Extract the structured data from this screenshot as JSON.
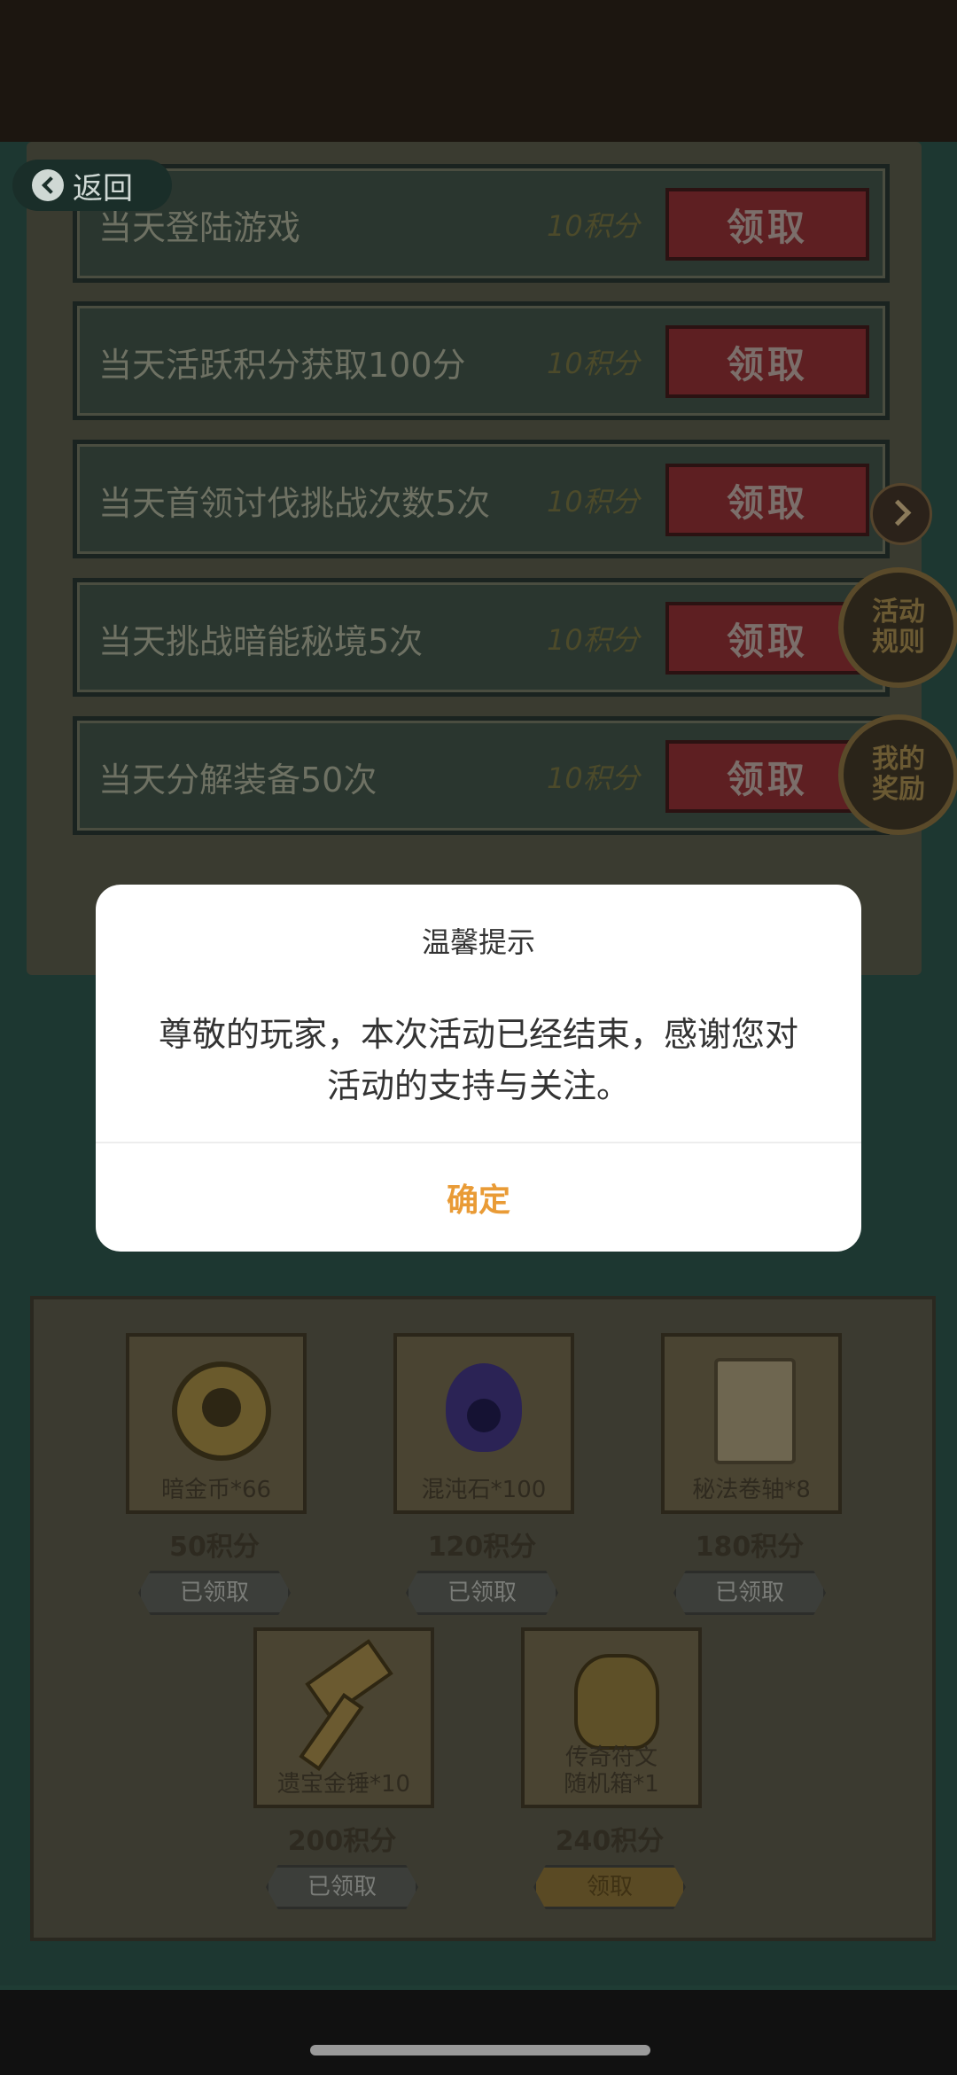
{
  "header": {
    "back_label": "返回"
  },
  "tasks": [
    {
      "name": "当天登陆游戏",
      "points": "10积分",
      "button": "领取"
    },
    {
      "name": "当天活跃积分获取100分",
      "points": "10积分",
      "button": "领取"
    },
    {
      "name": "当天首领讨伐挑战次数5次",
      "points": "10积分",
      "button": "领取"
    },
    {
      "name": "当天挑战暗能秘境5次",
      "points": "10积分",
      "button": "领取"
    },
    {
      "name": "当天分解装备50次",
      "points": "10积分",
      "button": "领取"
    }
  ],
  "side": {
    "rules_line1": "活动",
    "rules_line2": "规则",
    "rewards_line1": "我的",
    "rewards_line2": "奖励"
  },
  "rewards": [
    {
      "name": "暗金币*66",
      "score": "50积分",
      "status": "已领取"
    },
    {
      "name": "混沌石*100",
      "score": "120积分",
      "status": "已领取"
    },
    {
      "name": "秘法卷轴*8",
      "score": "180积分",
      "status": "已领取"
    },
    {
      "name": "遗宝金锤*10",
      "score": "200积分",
      "status": "已领取"
    },
    {
      "name_line1": "传奇符文",
      "name_line2": "随机箱*1",
      "score": "240积分",
      "status": "领取"
    }
  ],
  "dialog": {
    "title": "温馨提示",
    "message_line1": "尊敬的玩家，本次活动已经结束，感谢您对",
    "message_line2": "活动的支持与关注。",
    "confirm": "确定"
  }
}
